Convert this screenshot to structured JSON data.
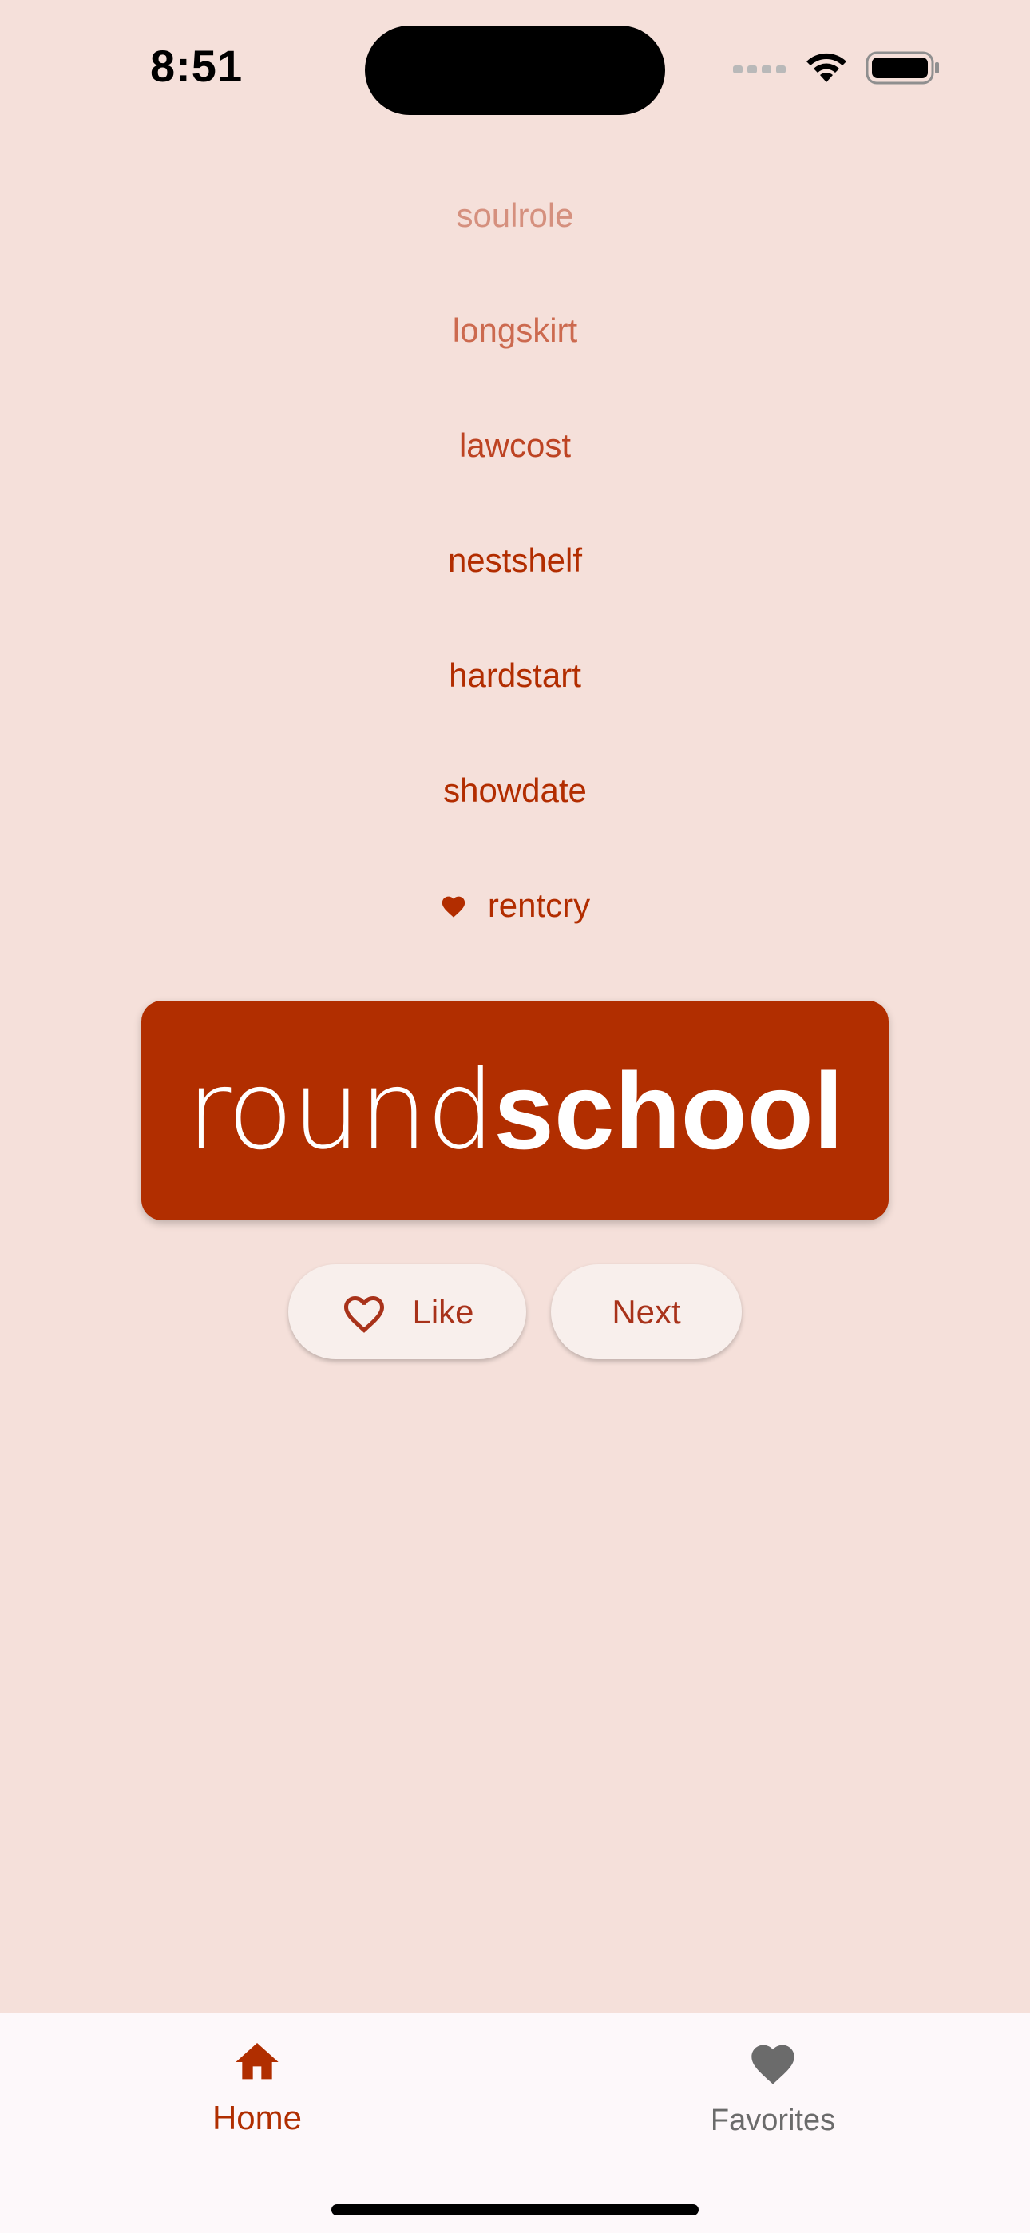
{
  "status_bar": {
    "time": "8:51"
  },
  "history": [
    {
      "word": "soulrole",
      "color": "#d5907e",
      "favorite": false
    },
    {
      "word": "longskirt",
      "color": "#cc6a4f",
      "favorite": false
    },
    {
      "word": "lawcost",
      "color": "#bd4322",
      "favorite": false
    },
    {
      "word": "nestshelf",
      "color": "#b22d00",
      "favorite": false
    },
    {
      "word": "hardstart",
      "color": "#b22d00",
      "favorite": false
    },
    {
      "word": "showdate",
      "color": "#b22d00",
      "favorite": false
    },
    {
      "word": "rentcry",
      "color": "#b22d00",
      "favorite": true
    }
  ],
  "current_pair": {
    "first": "round",
    "second": "school"
  },
  "actions": {
    "like_label": "Like",
    "next_label": "Next"
  },
  "nav": {
    "home_label": "Home",
    "favorites_label": "Favorites"
  },
  "colors": {
    "background": "#f5e0da",
    "primary": "#b12e00",
    "button_bg": "#f8efec",
    "nav_bg": "#fdf8fa",
    "inactive": "#6b6b6b"
  },
  "icons": {
    "status": [
      "cellular-icon",
      "wifi-icon",
      "battery-icon"
    ],
    "like": "heart-outline-icon",
    "history_favorite": "heart-icon",
    "nav_home": "home-icon",
    "nav_favorites": "heart-icon"
  }
}
